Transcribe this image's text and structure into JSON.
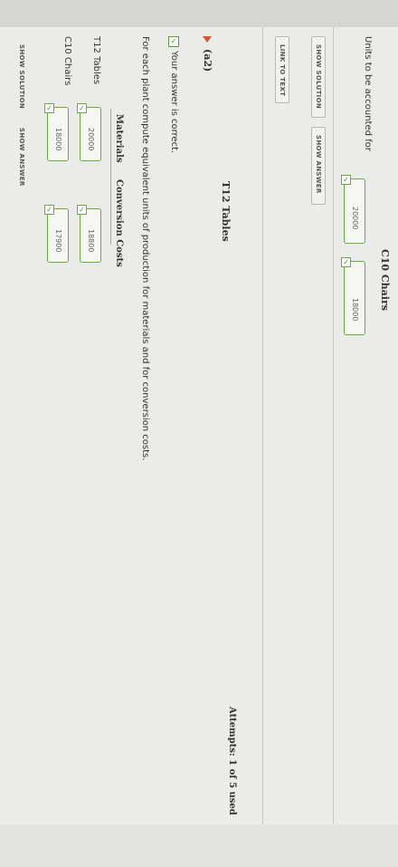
{
  "units_section": {
    "header_t12": "T12 Tables",
    "header_c10": "C10 Chairs",
    "row_label": "Units to be accounted for",
    "t12_value": "20000",
    "c10_value": "18000"
  },
  "buttons": {
    "show_solution": "SHOW SOLUTION",
    "show_answer": "SHOW ANSWER",
    "link_to_text": "LINK TO TEXT",
    "show_solution_2": "SHOW SOLUTION",
    "show_answer_2": "SHOW ANSWER"
  },
  "attempts": "Attempts: 1 of 5 used",
  "part_a2": {
    "label": "(a2)",
    "status": "Your answer is correct.",
    "instruction": "For each plant compute equivalent units of production for materials and for conversion costs.",
    "col_materials": "Materials",
    "col_conversion": "Conversion Costs",
    "rows": [
      {
        "label": "T12 Tables",
        "materials": "20000",
        "conversion": "18800"
      },
      {
        "label": "C10 Chairs",
        "materials": "18000",
        "conversion": "17900"
      }
    ]
  },
  "colors": {
    "correct_border": "#6bab3e",
    "triangle": "#d9532c"
  }
}
